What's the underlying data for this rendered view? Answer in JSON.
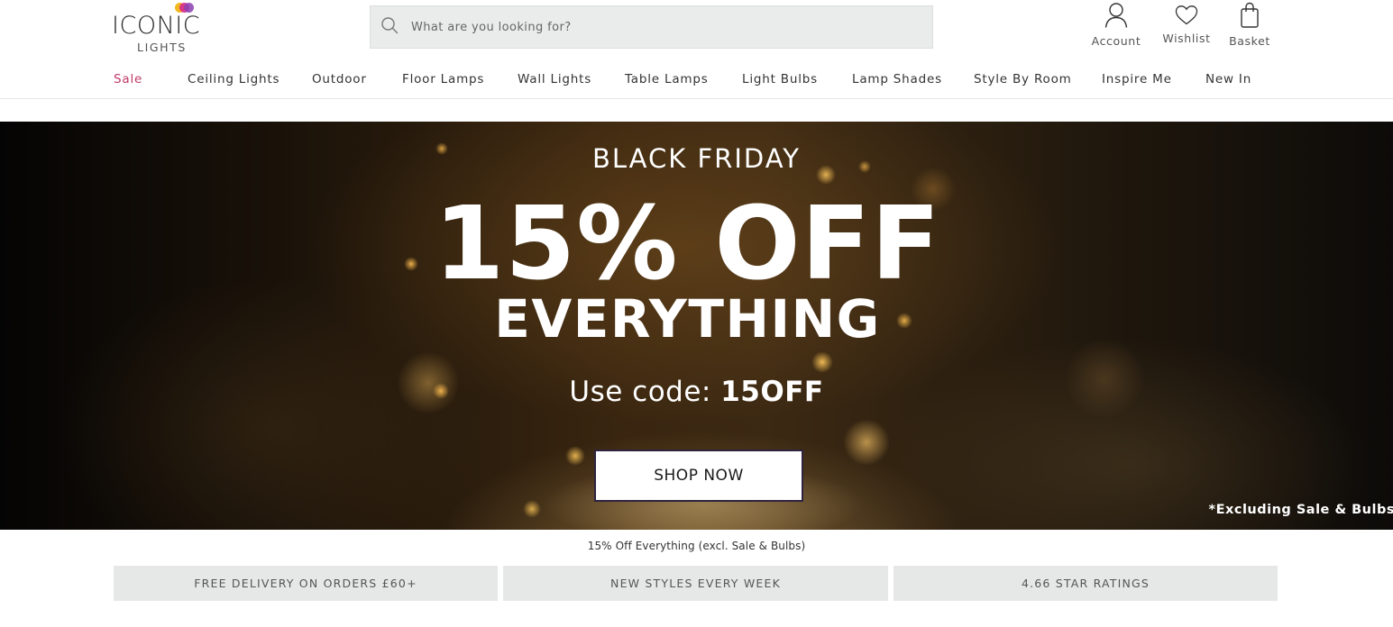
{
  "brand": {
    "name": "ICONIC",
    "sub": "LIGHTS",
    "dot_colors": [
      "#f2b81c",
      "#d62a8e",
      "#8b3fb0"
    ]
  },
  "search": {
    "placeholder": "What are you looking for?",
    "icon": "search-icon"
  },
  "header_actions": {
    "account": {
      "label": "Account",
      "icon": "user-icon"
    },
    "wishlist": {
      "label": "Wishlist",
      "icon": "heart-icon"
    },
    "basket": {
      "label": "Basket",
      "icon": "shopping-bag-icon"
    }
  },
  "nav": {
    "items": [
      {
        "label": "Sale"
      },
      {
        "label": "Ceiling Lights"
      },
      {
        "label": "Outdoor"
      },
      {
        "label": "Floor Lamps"
      },
      {
        "label": "Wall Lights"
      },
      {
        "label": "Table Lamps"
      },
      {
        "label": "Light Bulbs"
      },
      {
        "label": "Lamp Shades"
      },
      {
        "label": "Style By Room"
      },
      {
        "label": "Inspire Me"
      },
      {
        "label": "New In"
      }
    ],
    "sale_color": "#c0396b"
  },
  "hero": {
    "eyebrow": "BLACK FRIDAY",
    "headline": "15% OFF",
    "sub": "EVERYTHING",
    "code_prefix": "Use code: ",
    "code": "15OFF",
    "cta": "SHOP NOW",
    "note": "*Excluding Sale & Bulbs"
  },
  "promo_caption": "15% Off Everything (excl. Sale & Bulbs)",
  "usps": [
    {
      "label": "FREE DELIVERY ON ORDERS £60+"
    },
    {
      "label": "NEW STYLES EVERY WEEK"
    },
    {
      "label": "4.66 STAR RATINGS"
    }
  ]
}
